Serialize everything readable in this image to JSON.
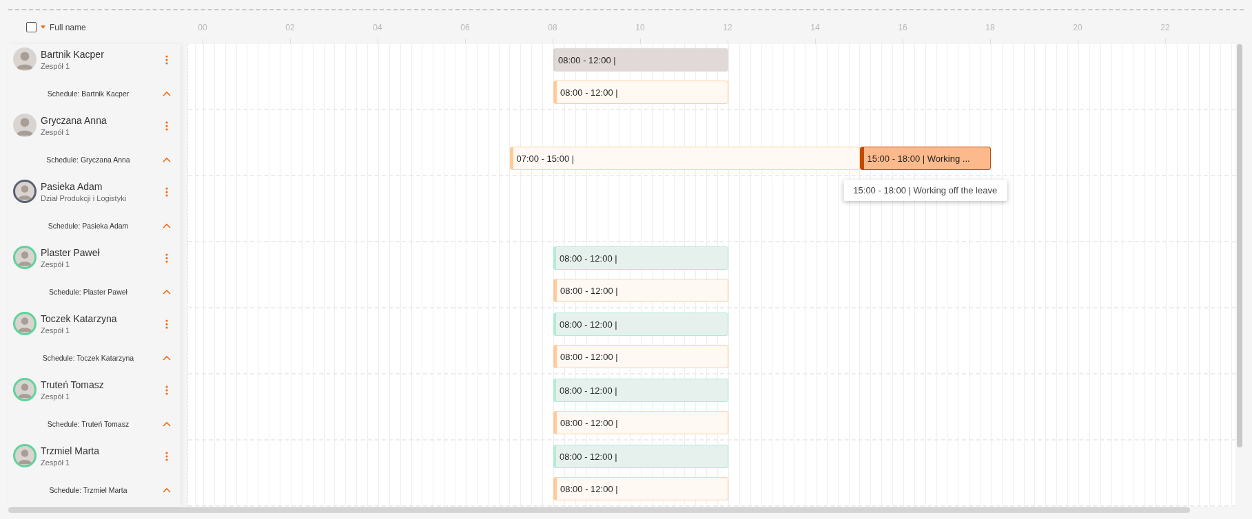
{
  "header": {
    "select_all": {
      "checked": false
    },
    "column_label": "Full name",
    "hours": [
      "00",
      "02",
      "04",
      "06",
      "08",
      "10",
      "12",
      "14",
      "16",
      "18",
      "20",
      "22"
    ]
  },
  "employees": [
    {
      "name": "Bartnik Kacper",
      "team": "Zespół 1",
      "schedule_label": "Schedule: Bartnik Kacper",
      "expanded": true,
      "person_bars": [
        {
          "label": "08:00 - 12:00 |",
          "kind": "planned"
        }
      ],
      "schedule_bars": [
        {
          "label": "08:00 - 12:00 |",
          "kind": "schedule"
        }
      ]
    },
    {
      "name": "Gryczana Anna",
      "team": "Zespół 1",
      "schedule_label": "Schedule: Gryczana Anna",
      "expanded": true,
      "schedule_bars": [
        {
          "label": "07:00 - 15:00 |",
          "kind": "schedule"
        },
        {
          "label": "15:00 - 18:00 | Working ...",
          "kind": "working-off",
          "tooltip": "15:00 - 18:00 | Working off the leave"
        }
      ]
    },
    {
      "name": "Pasieka Adam",
      "team": "Dział Produkcji i Logistyki",
      "color": "#5a6170",
      "schedule_label": "Schedule: Pasieka Adam",
      "expanded": true
    },
    {
      "name": "Plaster Paweł",
      "team": "Zespół 1",
      "color": "#5fd39a",
      "schedule_label": "Schedule: Plaster Paweł",
      "expanded": true,
      "person_bars": [
        {
          "label": "08:00 - 12:00 |",
          "kind": "actual"
        }
      ],
      "schedule_bars": [
        {
          "label": "08:00 - 12:00 |",
          "kind": "schedule"
        }
      ]
    },
    {
      "name": "Toczek Katarzyna",
      "team": "Zespół 1",
      "color": "#5fd39a",
      "schedule_label": "Schedule: Toczek Katarzyna",
      "expanded": true,
      "person_bars": [
        {
          "label": "08:00 - 12:00 |",
          "kind": "actual"
        }
      ],
      "schedule_bars": [
        {
          "label": "08:00 - 12:00 |",
          "kind": "schedule"
        }
      ]
    },
    {
      "name": "Truteń Tomasz",
      "team": "Zespół 1",
      "color": "#5fd39a",
      "schedule_label": "Schedule: Truteń Tomasz",
      "expanded": true,
      "person_bars": [
        {
          "label": "08:00 - 12:00 |",
          "kind": "actual"
        }
      ],
      "schedule_bars": [
        {
          "label": "08:00 - 12:00 |",
          "kind": "schedule"
        }
      ]
    },
    {
      "name": "Trzmiel Marta",
      "team": "Zespół 1",
      "color": "#5fd39a",
      "schedule_label": "Schedule: Trzmiel Marta",
      "expanded": true,
      "person_bars": [
        {
          "label": "08:00 - 12:00 |",
          "kind": "actual"
        }
      ],
      "schedule_bars": [
        {
          "label": "08:00 - 12:00 |",
          "kind": "schedule"
        }
      ]
    }
  ]
}
